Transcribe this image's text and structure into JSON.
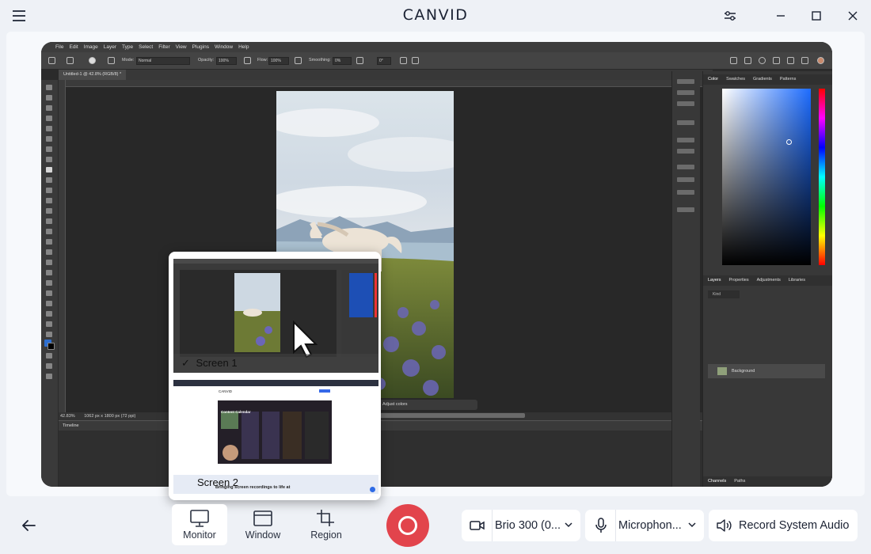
{
  "app": {
    "brand": "CANVID"
  },
  "photoshop": {
    "menu": [
      "File",
      "Edit",
      "Image",
      "Layer",
      "Type",
      "Select",
      "Filter",
      "View",
      "Plugins",
      "Window",
      "Help"
    ],
    "options": {
      "mode_label": "Mode:",
      "mode_value": "Normal",
      "opacity_label": "Opacity:",
      "opacity_value": "100%",
      "flow_label": "Flow:",
      "flow_value": "100%",
      "smoothing_label": "Smoothing:",
      "smoothing_value": "0%",
      "angle_value": "0°"
    },
    "doc_tab": "Untitled-1 @ 42.8% (RGB/8) *",
    "zoom": "42.83%",
    "doc_info": "1062 px x 1800 px (72 ppi)",
    "adjust_label": "Adjust colors",
    "timeline_label": "Timeline",
    "color_tabs": [
      "Color",
      "Swatches",
      "Gradients",
      "Patterns"
    ],
    "layer_tabs": [
      "Layers",
      "Properties",
      "Adjustments",
      "Libraries"
    ],
    "layer_name": "Background",
    "layer_kind": "Kind",
    "bottom_tabs": [
      "Channels",
      "Paths"
    ]
  },
  "picker": {
    "screens": [
      {
        "label": "Screen 1",
        "selected": true
      },
      {
        "label": "Screen 2",
        "selected": false
      }
    ],
    "screen2_brand": "CANVID",
    "screen2_calendar": "Content Calendar",
    "screen2_tagline": "Bringing screen recordings to life at"
  },
  "modes": {
    "monitor": "Monitor",
    "window": "Window",
    "region": "Region",
    "active": "monitor"
  },
  "devices": {
    "camera": "Brio 300 (0...",
    "microphone": "Microphon...",
    "system_audio": "Record System Audio"
  },
  "colors": {
    "record": "#e2444c",
    "accent": "#1d6cff"
  }
}
